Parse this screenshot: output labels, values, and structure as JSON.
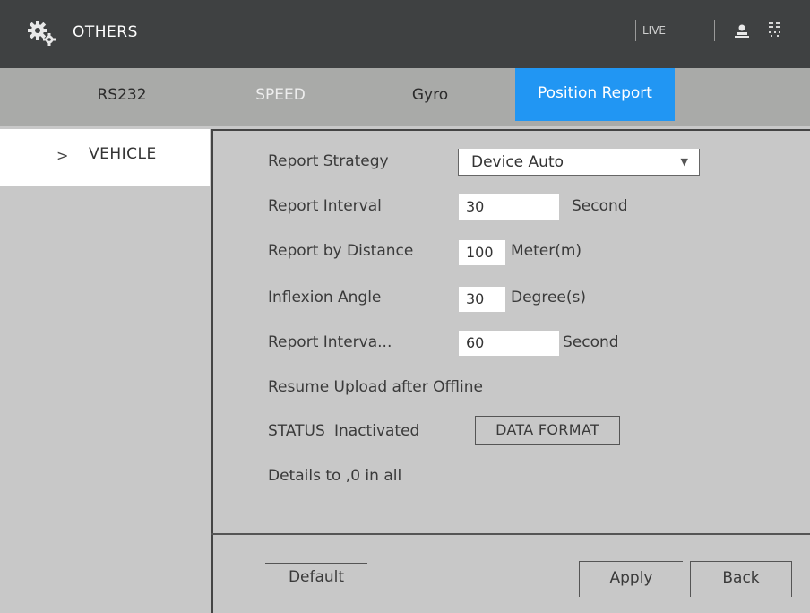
{
  "header": {
    "title": "OTHERS",
    "live_label": "LIVE",
    "gear_icon": "gear-icon",
    "user_icon": "user-icon",
    "grid_icon": "grid-icon"
  },
  "tabs": [
    {
      "label": "RS232",
      "active": false
    },
    {
      "label": "SPEED",
      "active": false
    },
    {
      "label": "Gyro",
      "active": false
    },
    {
      "label": "Position Report",
      "active": true
    }
  ],
  "sidebar": {
    "items": [
      {
        "label": "VEHICLE",
        "selected": true,
        "icon": "chevron-right-icon"
      }
    ]
  },
  "form": {
    "report_strategy_label": "Report Strategy",
    "report_strategy_value": "Device Auto",
    "report_interval_label": "Report Interval",
    "report_interval_value": "30",
    "report_interval_unit": "Second",
    "report_distance_label": "Report by Distance",
    "report_distance_value": "100",
    "report_distance_unit": "Meter(m)",
    "inflexion_label": "Inflexion Angle",
    "inflexion_value": "30",
    "inflexion_unit": "Degree(s)",
    "report_interval2_label": "Report Interva...",
    "report_interval2_value": "60",
    "report_interval2_unit": "Second",
    "resume_upload_label": "Resume Upload after Offline",
    "status_label": "STATUS",
    "status_value": "Inactivated",
    "data_format_button": "DATA FORMAT",
    "details_text": "Details  to ,0 in all"
  },
  "buttons": {
    "default": "Default",
    "apply": "Apply",
    "back": "Back"
  },
  "colors": {
    "titlebar": "#3f4142",
    "tabbar": "#a9aaa8",
    "active_tab": "#2196f3",
    "panel": "#c8c8c8"
  }
}
